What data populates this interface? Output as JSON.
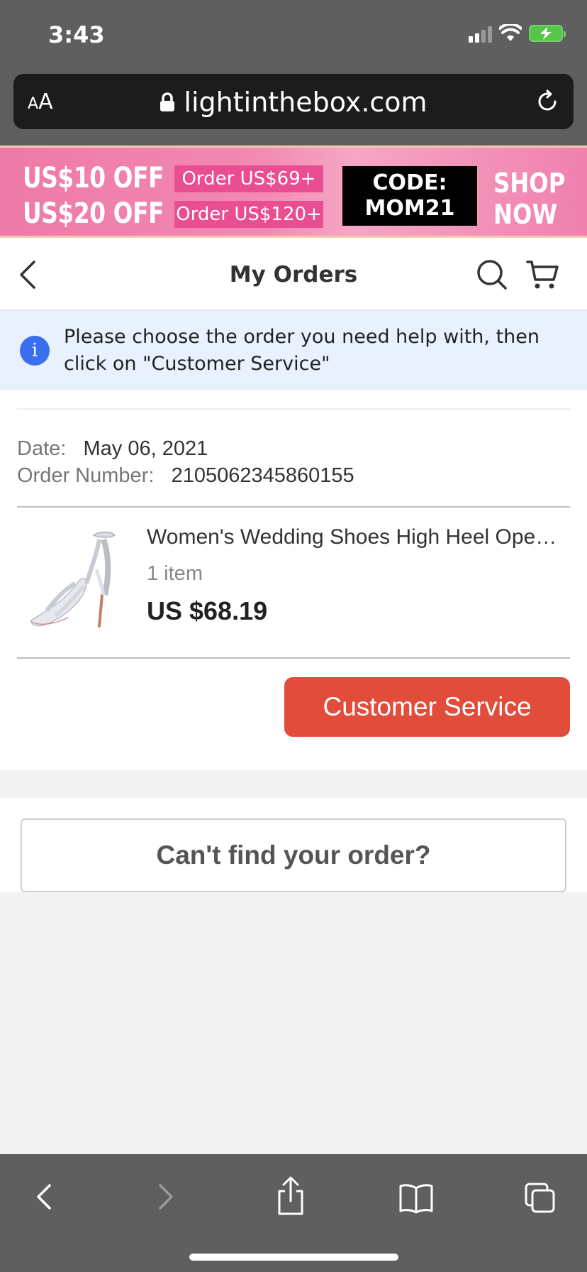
{
  "status_bar": {
    "time": "3:43"
  },
  "browser": {
    "text_size_label_small": "A",
    "text_size_label_large": "A",
    "url": "lightinthebox.com"
  },
  "promo": {
    "off_1": "US$10 OFF",
    "off_2": "US$20 OFF",
    "condition_1": "Order US$69+",
    "condition_2": "Order US$120+",
    "code_label": "CODE:",
    "code_value": "MOM21",
    "shop_line_1": "SHOP",
    "shop_line_2": "NOW",
    "colors": {
      "banner": "#f080af",
      "condition_bg": "#e94d92",
      "code_bg": "#000000"
    }
  },
  "header": {
    "title": "My Orders"
  },
  "notice": {
    "icon": "info-icon",
    "text": "Please choose the order you need help with, then click on \"Customer Service\""
  },
  "order": {
    "date_label": "Date:",
    "date_value": "May 06, 2021",
    "number_label": "Order Number:",
    "number_value": "2105062345860155",
    "product_name": "Women's Wedding Shoes High Heel Open Toe",
    "quantity": "1 item",
    "price": "US $68.19",
    "customer_service_label": "Customer Service",
    "colors": {
      "button": "#e24c3b"
    }
  },
  "cant_find": {
    "label": "Can't find your order?"
  },
  "toolbar": {
    "items": [
      "back-icon",
      "forward-icon",
      "share-icon",
      "bookmarks-icon",
      "tabs-icon"
    ]
  }
}
